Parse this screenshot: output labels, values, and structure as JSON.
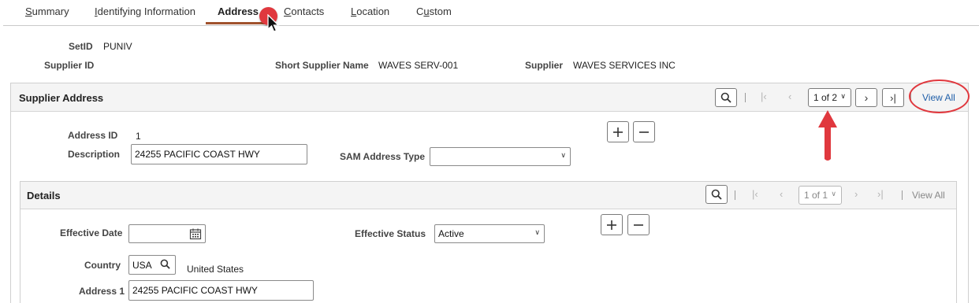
{
  "tabs": [
    {
      "label": "Summary",
      "underline_index": 0
    },
    {
      "label": "Identifying Information",
      "underline_index": 0
    },
    {
      "label": "Address",
      "underline_index": -1
    },
    {
      "label": "Contacts",
      "underline_index": 0
    },
    {
      "label": "Location",
      "underline_index": 0
    },
    {
      "label": "Custom",
      "underline_index": 1
    }
  ],
  "active_tab": "Address",
  "header": {
    "setid_label": "SetID",
    "setid_value": "PUNIV",
    "supplier_id_label": "Supplier ID",
    "supplier_id_value": "",
    "short_name_label": "Short Supplier Name",
    "short_name_value": "WAVES SERV-001",
    "supplier_label": "Supplier",
    "supplier_value": "WAVES SERVICES INC"
  },
  "supplier_address": {
    "title": "Supplier Address",
    "pagination": "1 of 2",
    "view_all": "View All",
    "address_id_label": "Address ID",
    "address_id_value": "1",
    "description_label": "Description",
    "description_value": "24255 PACIFIC COAST HWY",
    "sam_label": "SAM Address Type",
    "sam_value": ""
  },
  "details": {
    "title": "Details",
    "pagination": "1 of 1",
    "view_all": "View All",
    "effective_date_label": "Effective Date",
    "effective_date_value": "",
    "effective_status_label": "Effective Status",
    "effective_status_value": "Active",
    "country_label": "Country",
    "country_code": "USA",
    "country_name": "United States",
    "address1_label": "Address 1",
    "address1_value": "24255 PACIFIC COAST HWY"
  },
  "colors": {
    "accent_underline": "#a0522d",
    "annotation": "#e0383e",
    "link": "#1f5ea8"
  },
  "icons": [
    "search-icon",
    "first-page-icon",
    "prev-page-icon",
    "next-page-icon",
    "last-page-icon",
    "plus-icon",
    "minus-icon",
    "calendar-icon",
    "chevron-down-icon",
    "mouse-cursor-icon",
    "red-arrow-icon"
  ]
}
